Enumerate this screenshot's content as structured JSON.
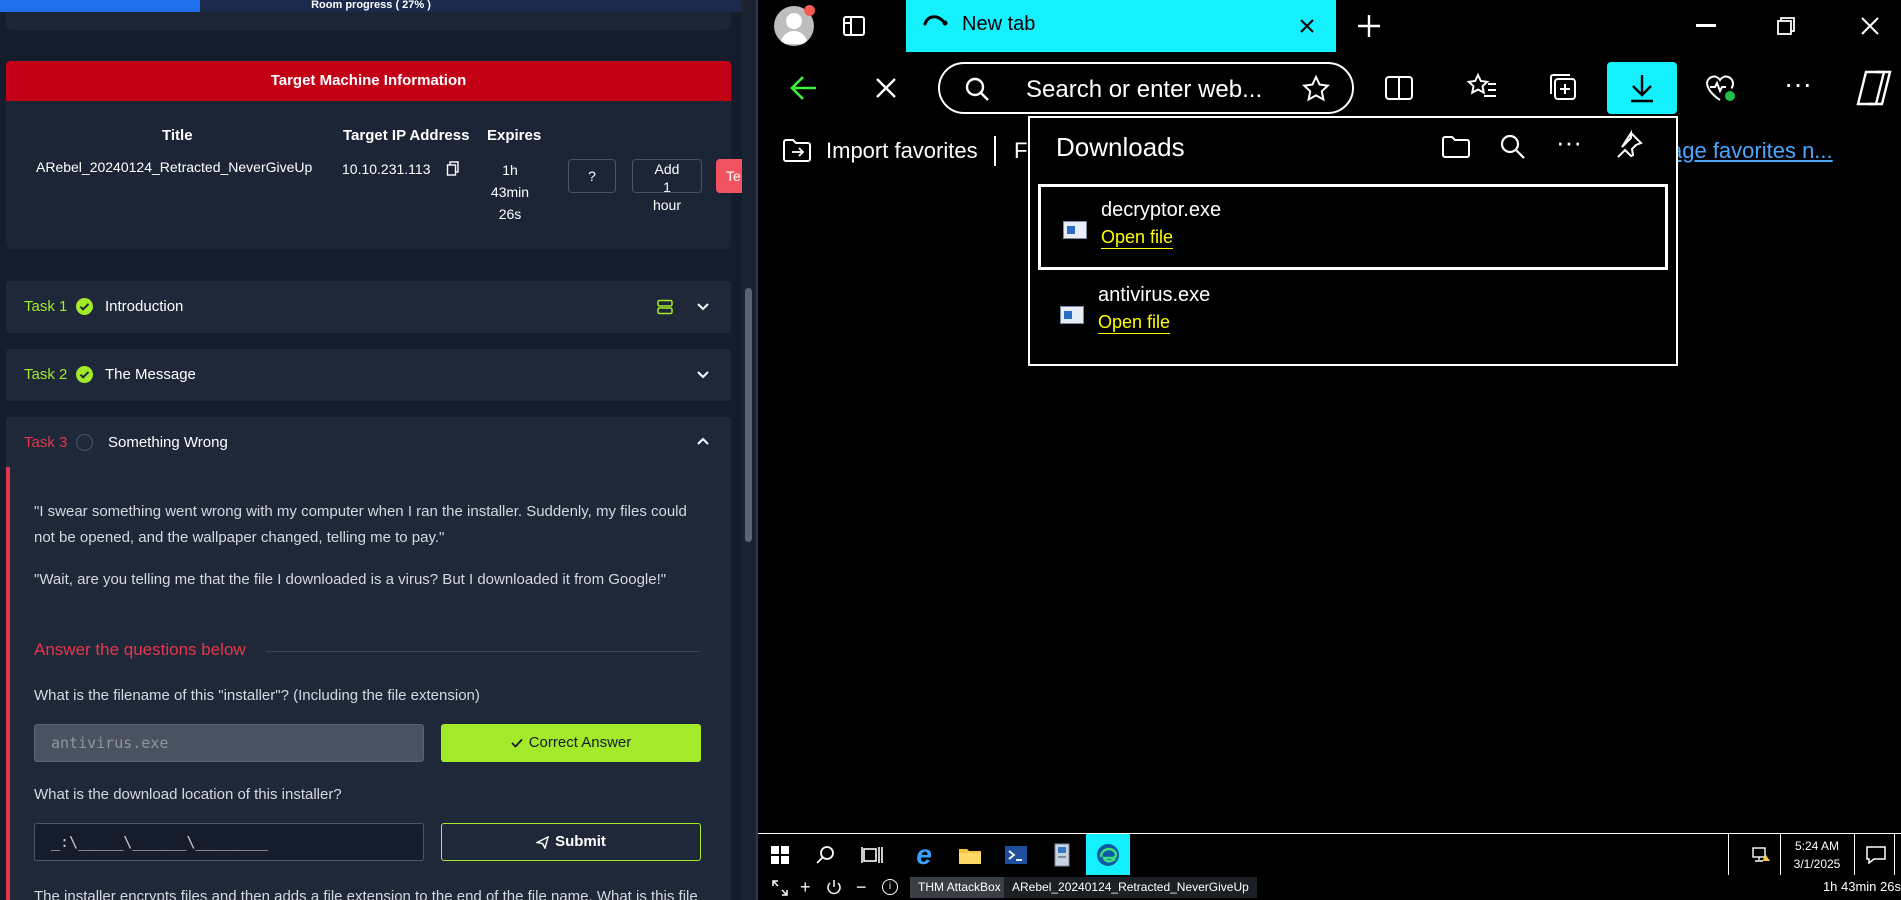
{
  "room": {
    "progress_label": "Room progress ( 27% )",
    "progress_percent": 27
  },
  "target": {
    "header": "Target Machine Information",
    "col_title": "Title",
    "col_ip": "Target IP Address",
    "col_expires": "Expires",
    "title_value": "ARebel_20240124_Retracted_NeverGiveUp",
    "ip_value": "10.10.231.113",
    "expires_lines": [
      "1h",
      "43min",
      "26s"
    ],
    "help_label": "?",
    "add_hour_lines": [
      "Add",
      "1",
      "hour"
    ],
    "terminate_label": "Te"
  },
  "tasks": [
    {
      "num": "Task 1",
      "title": "Introduction",
      "done": true
    },
    {
      "num": "Task 2",
      "title": "The Message",
      "done": true
    },
    {
      "num": "Task 3",
      "title": "Something Wrong",
      "done": false
    }
  ],
  "task3": {
    "para1_line1": "\"I swear something went wrong with my computer when I ran the installer. Suddenly, my files could",
    "para1_line2": "not be opened, and the wallpaper changed, telling me to pay.\"",
    "para2": "\"Wait, are you telling me that the file I downloaded is a virus? But I downloaded it from Google!\"",
    "answer_heading": "Answer the questions below",
    "q1": "What is the filename of this \"installer\"? (Including the file extension)",
    "q1_answer": "antivirus.exe",
    "q1_button": "Correct Answer",
    "q2": "What is the download location of this installer?",
    "q2_placeholder": "_:\\_____\\______\\________",
    "q2_button": "Submit",
    "q3_partial": "The installer encrypts files and then adds a file extension to the end of the file name. What is this file"
  },
  "browser": {
    "tab_title": "New tab",
    "address_placeholder": "Search or enter web...",
    "fav_import": "Import favorites",
    "fav_second": "Fo",
    "fav_manage": "age favorites n...",
    "downloads": {
      "title": "Downloads",
      "items": [
        {
          "name": "decryptor.exe",
          "action": "Open file"
        },
        {
          "name": "antivirus.exe",
          "action": "Open file"
        }
      ]
    }
  },
  "taskbar": {
    "time": "5:24 AM",
    "date": "3/1/2025",
    "tab1": "THM AttackBox",
    "tab2": "ARebel_20240124_Retracted_NeverGiveUp",
    "timer": "1h 43min 26s"
  },
  "colors": {
    "accent_cyan": "#15f0ff",
    "tryhackme_red": "#c40016",
    "success_green": "#a3ea2a",
    "link_yellow": "#ffff00"
  }
}
